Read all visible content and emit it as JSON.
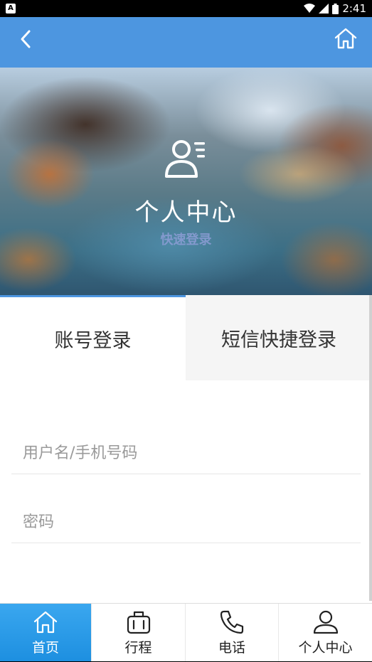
{
  "status_bar": {
    "notification_icon": "A",
    "time": "2:41",
    "icons": [
      "wifi-icon",
      "signal-icon",
      "battery-icon"
    ]
  },
  "nav": {
    "back_icon": "chevron-left-icon",
    "home_icon": "home-icon",
    "color": "#4d96e0"
  },
  "hero": {
    "title": "个人中心",
    "subtitle": "快速登录",
    "icon": "user-profile-icon"
  },
  "tabs": [
    {
      "label": "账号登录",
      "active": true
    },
    {
      "label": "短信快捷登录",
      "active": false
    }
  ],
  "form": {
    "username_placeholder": "用户名/手机号码",
    "password_placeholder": "密码"
  },
  "bottom_nav": [
    {
      "label": "首页",
      "icon": "home-icon",
      "active": true
    },
    {
      "label": "行程",
      "icon": "suitcase-icon",
      "active": false
    },
    {
      "label": "电话",
      "icon": "phone-icon",
      "active": false
    },
    {
      "label": "个人中心",
      "icon": "person-icon",
      "active": false
    }
  ],
  "colors": {
    "accent": "#4d96e0",
    "active_tab": "#1d8fe0"
  }
}
